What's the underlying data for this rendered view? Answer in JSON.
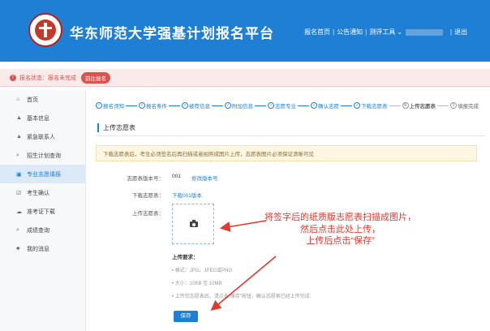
{
  "header": {
    "site_title": "华东师范大学强基计划报名平台",
    "nav": {
      "home": "报名首页",
      "notice": "公告通知",
      "tools": "测评工具",
      "tools_caret": "⌄",
      "logout": "退出"
    }
  },
  "status": {
    "icon": "!",
    "text": "报名状态：报名未完成",
    "button": "前往报名"
  },
  "sidebar": {
    "items": [
      {
        "icon": "⌂",
        "label": "首页"
      },
      {
        "icon": "▲",
        "label": "基本信息"
      },
      {
        "icon": "▲",
        "label": "紧急联系人"
      },
      {
        "icon": "⌕",
        "label": "招生计划查询"
      },
      {
        "icon": "▣",
        "label": "专业志愿填报"
      },
      {
        "icon": "☑",
        "label": "考生确认"
      },
      {
        "icon": "☁",
        "label": "准考证下载"
      },
      {
        "icon": "⌕",
        "label": "成绩查询"
      },
      {
        "icon": "♣",
        "label": "我的消息"
      }
    ]
  },
  "steps": [
    {
      "mark": "✓",
      "label": "报名须知"
    },
    {
      "mark": "✓",
      "label": "报名条件"
    },
    {
      "mark": "✓",
      "label": "被荐信息"
    },
    {
      "mark": "✓",
      "label": "附加信息"
    },
    {
      "mark": "✓",
      "label": "志愿专业"
    },
    {
      "mark": "✓",
      "label": "确认志愿"
    },
    {
      "mark": "✓",
      "label": "下载志愿表"
    },
    {
      "mark": "8",
      "label": "上传志愿表"
    },
    {
      "mark": "9",
      "label": "填报完成"
    }
  ],
  "section_title": "上传志愿表",
  "notice": "下载志愿表后，考生必须签名后再扫描或者拍照成图片上传，志愿表图片必须保证清晰可见",
  "form": {
    "version_label": "志愿表版本号：",
    "version_value": "001",
    "version_link": "修改版本号",
    "download_label": "下载志愿表：",
    "download_link": "下载001版本",
    "upload_label": "上传志愿表："
  },
  "requirements": {
    "title": "上传要求：",
    "items": [
      "• 格式：JPG、JPEG或PNG",
      "• 大小：10KB 至 10MB",
      "• 上传完志愿表后，请点击“保存”按钮，确认志愿表已经上传完成"
    ]
  },
  "save_button": "保存",
  "annotation": {
    "line1": "将签字后的纸质版志愿表扫描成图片，",
    "line2": "然后点击此处上传，",
    "line3": "上传后点击“保存”"
  },
  "colors": {
    "brand": "#1f7fd4",
    "danger": "#d9534f",
    "annotation": "#e03a2f"
  }
}
